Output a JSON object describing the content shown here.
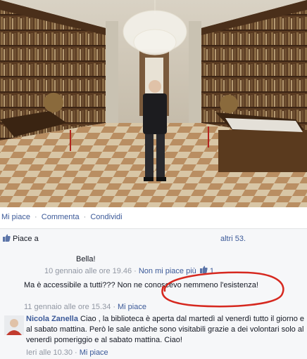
{
  "actions": {
    "like": "Mi piace",
    "comment": "Commenta",
    "share": "Condividi",
    "separator": "·"
  },
  "likes": {
    "piace_a": "Piace a",
    "altri": "altri 53."
  },
  "comments": [
    {
      "text": "Bella!",
      "date": "10 gennaio alle ore 19.46",
      "action": "Non mi piace più",
      "like_count": "1"
    },
    {
      "text": "Ma è accessibile a tutti??? Non ne conoscevo nemmeno l'esistenza!",
      "date": "11 gennaio alle ore 15.34",
      "action": "Mi piace"
    },
    {
      "author": "Nicola Zanella",
      "text": "Ciao          , la biblioteca è aperta dal martedì al venerdì tutto il giorno e al sabato mattina. Però le sale antiche sono visitabili grazie a dei volontari solo al venerdì pomeriggio e al sabato mattina. Ciao!",
      "date": "Ieri alle 10.30",
      "action": "Mi piace"
    }
  ],
  "colors": {
    "link": "#3b5998",
    "meta": "#9197a3",
    "highlight_oval": "#d6281f"
  }
}
